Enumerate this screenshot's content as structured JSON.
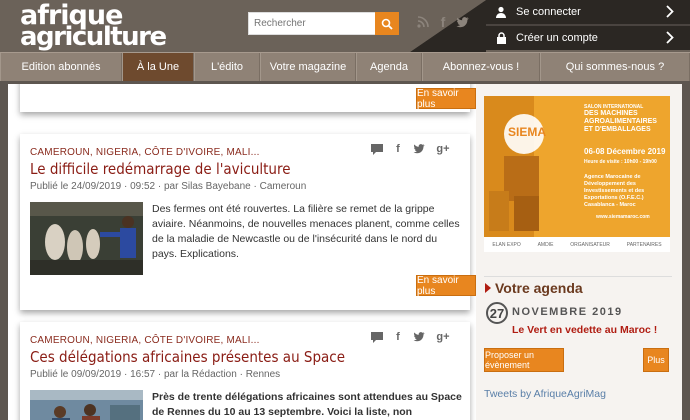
{
  "site": {
    "logo_line1": "afrique",
    "logo_line2": "agriculture"
  },
  "search": {
    "placeholder": "Rechercher"
  },
  "social": [
    "rss-icon",
    "facebook-icon",
    "twitter-icon"
  ],
  "account": {
    "login_label": "Se connecter",
    "register_label": "Créer un compte"
  },
  "nav": {
    "items": [
      {
        "label": "Edition abonnés"
      },
      {
        "label": "À la Une"
      },
      {
        "label": "L'édito"
      },
      {
        "label": "Votre magazine"
      },
      {
        "label": "Agenda"
      },
      {
        "label": "Abonnez-vous !"
      },
      {
        "label": "Qui sommes-nous ?"
      }
    ],
    "active_index": 1
  },
  "articles": [
    {
      "button": "En savoir plus"
    },
    {
      "categories": "CAMEROUN, NIGERIA, CÔTE D'IVOIRE, MALI...",
      "title": "Le difficile redémarrage de l'aviculture",
      "meta": "Publié le 24/09/2019 · 09:52 · par Silas Bayebane · Cameroun",
      "summary": "Des fermes ont été rouvertes. La filière se remet de la grippe aviaire.  Néanmoins, de nouvelles menaces planent, comme celles de la maladie de Newcastle ou de l'insécurité dans le nord du pays. Explications.",
      "button": "En savoir plus"
    },
    {
      "categories": "CAMEROUN, NIGERIA, CÔTE D'IVOIRE, MALI...",
      "title": "Ces délégations africaines présentes au Space",
      "meta": "Publié le 09/09/2019 · 16:57 · par la Rédaction · Rennes",
      "summary": "Près de trente délégations africaines sont attendues au Space de Rennes du 10 au 13 septembre. Voici la liste, non exhaustive,"
    }
  ],
  "ad": {
    "brand": "SIEMA",
    "line1": "SALON INTERNATIONAL",
    "line2": "DES MACHINES AGROALIMENTAIRES ET D'EMBALLAGES",
    "dates": "06-08 Décembre 2019",
    "hours": "Heure de visite : 10h00 - 19h00",
    "org": "Agence Marocaine de Développement des Investissements et des Exportations (O.F.E.C.) Casablanca - Maroc",
    "site": "www.siemamaroc.com"
  },
  "agenda": {
    "heading": "Votre agenda",
    "day": "27",
    "month": "NOVEMBRE 2019",
    "event": "Le Vert en vedette au Maroc !",
    "propose_label": "Proposer un évènement",
    "more_label": "Plus"
  },
  "tweets_label": "Tweets by AfriqueAgriMag",
  "colors": {
    "accent": "#e8861f",
    "title_red": "#8a1c14",
    "nav_bg": "#8f8276",
    "nav_active": "#6e4a2e"
  }
}
